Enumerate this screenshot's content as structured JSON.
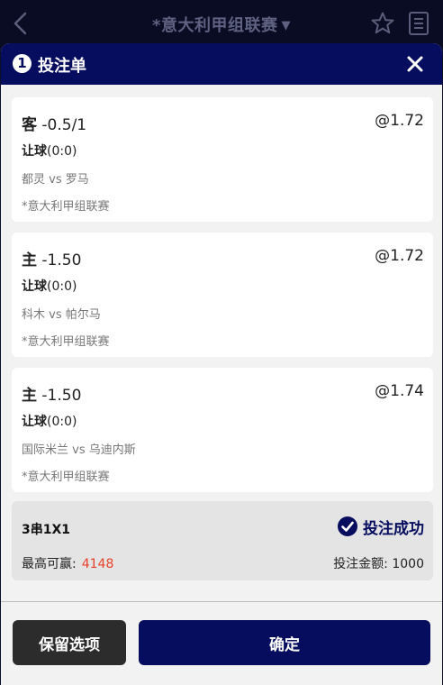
{
  "topbar": {
    "league_title": "*意大利甲组联赛",
    "caret": "▼",
    "icons": [
      "back-icon",
      "star-icon",
      "document-icon"
    ]
  },
  "slip": {
    "count": "1",
    "title": "投注单",
    "close_icon": "close-icon"
  },
  "bets": [
    {
      "side": "客",
      "line": " -0.5/1",
      "odds": "@1.72",
      "type_label": "让球",
      "type_score": "(0:0)",
      "match_home": "都灵",
      "vs": " vs ",
      "match_away": "罗马",
      "league": "*意大利甲组联赛"
    },
    {
      "side": "主",
      "line": " -1.50",
      "odds": "@1.72",
      "type_label": "让球",
      "type_score": "(0:0)",
      "match_home": "科木",
      "vs": " vs ",
      "match_away": "帕尔马",
      "league": "*意大利甲组联赛"
    },
    {
      "side": "主",
      "line": " -1.50",
      "odds": "@1.74",
      "type_label": "让球",
      "type_score": "(0:0)",
      "match_home": "国际米兰",
      "vs": " vs ",
      "match_away": "乌迪内斯",
      "league": "*意大利甲组联赛"
    }
  ],
  "summary": {
    "combo": "3串1X1",
    "status": "投注成功",
    "max_win_label": "最高可赢:",
    "max_win_value": "4148",
    "stake_label": "投注金额:",
    "stake_value": "1000"
  },
  "buttons": {
    "keep": "保留选项",
    "confirm": "确定"
  },
  "colors": {
    "brand_navy": "#060c5e",
    "win_red": "#e8412a",
    "keep_button": "#2c2c2c"
  }
}
